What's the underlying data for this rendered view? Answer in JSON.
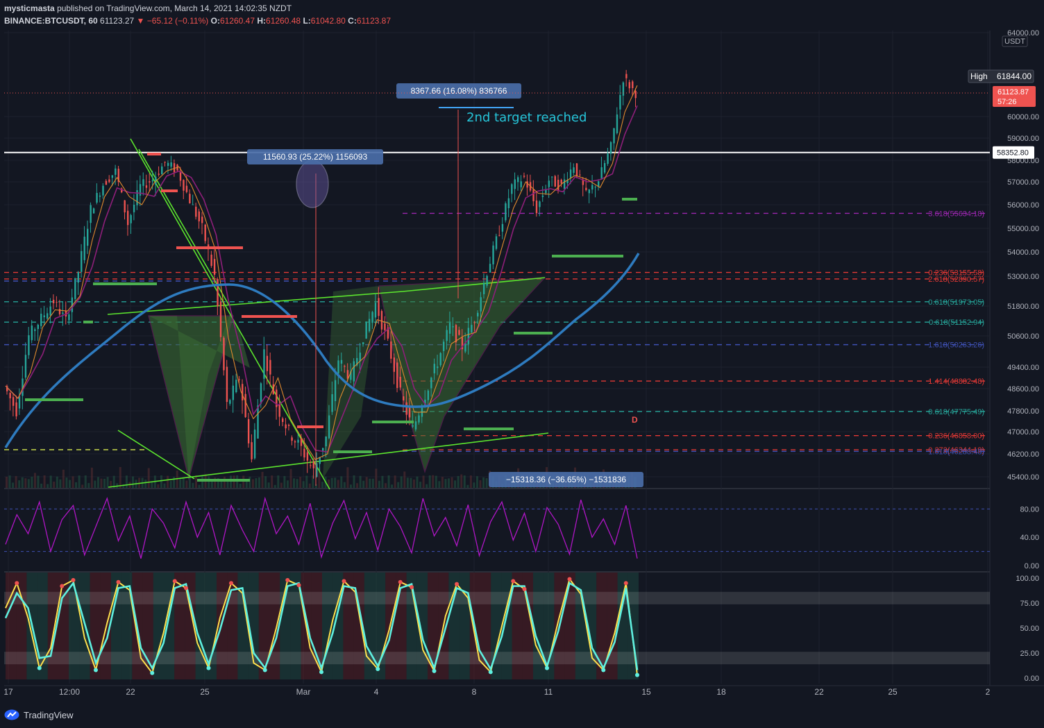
{
  "header": {
    "author": "mysticmasta",
    "published_text": "published on TradingView.com, March 14, 2021 14:02:35 NZDT",
    "symbol": "BINANCE:BTCUSDT, 60",
    "price": "61123.27",
    "change": "▼ −65.12 (−0.11%)",
    "o_label": "O:",
    "o": "61260.47",
    "h_label": "H:",
    "h": "61260.48",
    "l_label": "L:",
    "l": "61042.80",
    "c_label": "C:",
    "c": "61123.87"
  },
  "footer": {
    "brand": "TradingView"
  },
  "colors": {
    "bg": "#131722",
    "up": "#26a69a",
    "down": "#ef5350",
    "grid": "#1e222d",
    "ma_blue": "#2e7bbf",
    "trend": "#5ce62e",
    "pattern_fill": "#3a6b34",
    "axis_text": "#b2b5be"
  },
  "chart_data": [
    {
      "type": "candlestick",
      "title": "",
      "currency_label": "USDT",
      "x_ticks": [
        "17",
        "12:00",
        "22",
        "25",
        "Mar",
        "4",
        "8",
        "11",
        "15",
        "18",
        "22",
        "25",
        "2"
      ],
      "y_ticks": [
        64000,
        60000,
        59000,
        58000,
        57000,
        56000,
        55000,
        54000,
        53000,
        51800,
        50600,
        49400,
        48600,
        47800,
        47000,
        46200,
        45400
      ],
      "y_tick_labels": [
        "64000.00",
        "60000.00",
        "59000.00",
        "58000.00",
        "57000.00",
        "56000.00",
        "55000.00",
        "54000.00",
        "53000.00",
        "51800.00",
        "50600.00",
        "49400.00",
        "48600.00",
        "47800.00",
        "47000.00",
        "46200.00",
        "45400.00"
      ],
      "axis_badges": {
        "high_label": "High",
        "high_value": "61844.00",
        "last_price": "61123.87",
        "countdown": "57:26",
        "hline_value": "58352.80"
      },
      "price_path": [
        [
          0,
          48700
        ],
        [
          3,
          47800
        ],
        [
          6,
          50600
        ],
        [
          8,
          51300
        ],
        [
          10,
          52000
        ],
        [
          11,
          51200
        ],
        [
          12,
          53200
        ],
        [
          13,
          55800
        ],
        [
          14,
          56900
        ],
        [
          15,
          57500
        ],
        [
          16,
          55200
        ],
        [
          17,
          56800
        ],
        [
          18,
          57100
        ],
        [
          19,
          57900
        ],
        [
          20,
          57500
        ],
        [
          21,
          56200
        ],
        [
          22,
          55000
        ],
        [
          23,
          53000
        ],
        [
          24,
          48000
        ],
        [
          25,
          49000
        ],
        [
          26,
          46000
        ],
        [
          27,
          50000
        ],
        [
          28,
          48000
        ],
        [
          29,
          47000
        ],
        [
          30,
          46400
        ],
        [
          31,
          45600
        ],
        [
          32,
          46800
        ],
        [
          33,
          49700
        ],
        [
          34,
          49000
        ],
        [
          35,
          50600
        ],
        [
          36,
          51900
        ],
        [
          37,
          50300
        ],
        [
          38,
          48400
        ],
        [
          39,
          47100
        ],
        [
          40,
          48400
        ],
        [
          41,
          49600
        ],
        [
          42,
          51000
        ],
        [
          43,
          50200
        ],
        [
          44,
          51300
        ],
        [
          45,
          53200
        ],
        [
          46,
          54900
        ],
        [
          47,
          56800
        ],
        [
          48,
          57200
        ],
        [
          49,
          55800
        ],
        [
          50,
          57100
        ],
        [
          51,
          56800
        ],
        [
          52,
          57800
        ],
        [
          53,
          56400
        ],
        [
          54,
          57100
        ],
        [
          55,
          58600
        ],
        [
          56,
          61844
        ],
        [
          57,
          61123
        ]
      ],
      "fib_levels": [
        {
          "label": "3.618(55634.18)",
          "value": 55634.18,
          "color": "#9c27b0"
        },
        {
          "label": "0.236(53155.58)",
          "value": 53155.58,
          "color": "#e53935"
        },
        {
          "label": "2.618(52890.57)",
          "value": 52890.57,
          "color": "#e53935"
        },
        {
          "label": "0.618(51973.05)",
          "value": 51973.05,
          "color": "#26a69a"
        },
        {
          "label": "0.618(51152.94)",
          "value": 51152.94,
          "color": "#26a69a"
        },
        {
          "label": "1.618(50263.26)",
          "value": 50263.26,
          "color": "#3f51b5"
        },
        {
          "label": "1.414(48882.48)",
          "value": 48882.48,
          "color": "#e53935"
        },
        {
          "label": "0.618(47775.49)",
          "value": 47775.49,
          "color": "#26a69a"
        },
        {
          "label": "0.236(46858.00)",
          "value": 46858.0,
          "color": "#e53935"
        },
        {
          "label": "0.272(46344.19)",
          "value": 46344.19,
          "color": "#e53935"
        },
        {
          "label": "1.618(46288.48)",
          "value": 46288.48,
          "color": "#3f51b5"
        }
      ],
      "annotations": [
        {
          "kind": "measure",
          "text": "8367.66 (16.08%) 836766"
        },
        {
          "kind": "measure",
          "text": "11560.93 (25.22%) 1156093"
        },
        {
          "kind": "measure",
          "text": "−15318.36 (−36.65%) −1531836"
        },
        {
          "kind": "note",
          "text": "2nd target reached"
        },
        {
          "kind": "point",
          "text": "D"
        }
      ]
    },
    {
      "type": "line",
      "title": "",
      "y_ticks": [
        0,
        40,
        80
      ],
      "y_tick_labels": [
        "0.00",
        "40.00",
        "80.00"
      ],
      "ylim": [
        0,
        100
      ],
      "series": [
        {
          "values": [
            30,
            72,
            45,
            90,
            20,
            65,
            85,
            15,
            55,
            95,
            35,
            70,
            10,
            80,
            60,
            25,
            90,
            40,
            75,
            15,
            85,
            50,
            20,
            95,
            45,
            70,
            30,
            88,
            12,
            60,
            92,
            38,
            75,
            22,
            80,
            55,
            18,
            95,
            42,
            68,
            28,
            86,
            14,
            62,
            90,
            36,
            74,
            20,
            82,
            58,
            16,
            93,
            40,
            66,
            30,
            85,
            10
          ]
        }
      ]
    },
    {
      "type": "line",
      "title": "",
      "y_ticks": [
        0,
        25,
        50,
        75,
        100
      ],
      "y_tick_labels": [
        "0.00",
        "25.00",
        "50.00",
        "75.00",
        "100.00"
      ],
      "ylim": [
        0,
        100
      ],
      "series": [
        {
          "values": [
            70,
            95,
            60,
            10,
            30,
            92,
            98,
            40,
            8,
            55,
            96,
            88,
            20,
            5,
            45,
            97,
            90,
            35,
            10,
            60,
            95,
            85,
            15,
            8,
            50,
            98,
            93,
            30,
            6,
            58,
            97,
            86,
            22,
            9,
            48,
            96,
            91,
            28,
            7,
            62,
            94,
            80,
            18,
            6,
            52,
            97,
            89,
            33,
            10,
            57,
            99,
            84,
            20,
            8,
            45,
            95,
            3
          ]
        },
        {
          "values": [
            60,
            85,
            70,
            20,
            22,
            80,
            95,
            55,
            15,
            40,
            90,
            92,
            30,
            10,
            35,
            90,
            94,
            45,
            14,
            48,
            88,
            90,
            25,
            10,
            40,
            92,
            95,
            40,
            10,
            45,
            92,
            90,
            32,
            12,
            38,
            90,
            94,
            38,
            10,
            50,
            90,
            85,
            28,
            9,
            42,
            92,
            92,
            42,
            12,
            47,
            95,
            88,
            30,
            10,
            36,
            90,
            8
          ]
        }
      ]
    }
  ]
}
